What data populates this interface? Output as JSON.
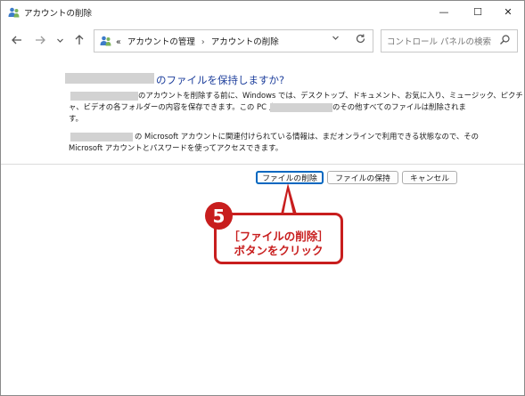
{
  "window": {
    "title": "アカウントの削除",
    "controls": {
      "minimize": "—",
      "maximize": "☐",
      "close": "✕"
    }
  },
  "navigation": {
    "back_icon": "arrow-left",
    "forward_icon": "arrow-right",
    "recent_icon": "chevron-down",
    "up_icon": "arrow-up",
    "breadcrumb_prefix": "«",
    "breadcrumb": [
      "アカウントの管理",
      "アカウントの削除"
    ],
    "breadcrumb_separator": "›",
    "address_dropdown_icon": "chevron-down",
    "refresh_icon": "refresh",
    "search_placeholder": "コントロール パネルの検索",
    "search_icon": "search"
  },
  "dialog": {
    "heading": "のファイルを保持しますか?",
    "paragraph1": {
      "line1": "のアカウントを削除する前に、Windows では、デスクトップ、ドキュメント、お気に入り、ミュージック、ピクチ",
      "line2a": "ャ、ビデオの各フォルダーの内容を保存できます。この PC 上にある",
      "line2b": "のその他すべてのファイルは削除されま",
      "line3": "す。"
    },
    "paragraph2": {
      "line1": "の Microsoft アカウントに関連付けられている情報は、まだオンラインで利用できる状態なので、その",
      "line2": "Microsoft アカウントとパスワードを使ってアクセスできます。"
    },
    "buttons": {
      "delete": "ファイルの削除",
      "keep": "ファイルの保持",
      "cancel": "キャンセル"
    }
  },
  "annotation": {
    "step": "5",
    "line1": "［ファイルの削除］",
    "line2": "ボタンをクリック",
    "color": "#c81e1e"
  },
  "colors": {
    "heading": "#1e3f9c",
    "focus_border": "#0067c0",
    "redaction": "#d2d2d2"
  }
}
